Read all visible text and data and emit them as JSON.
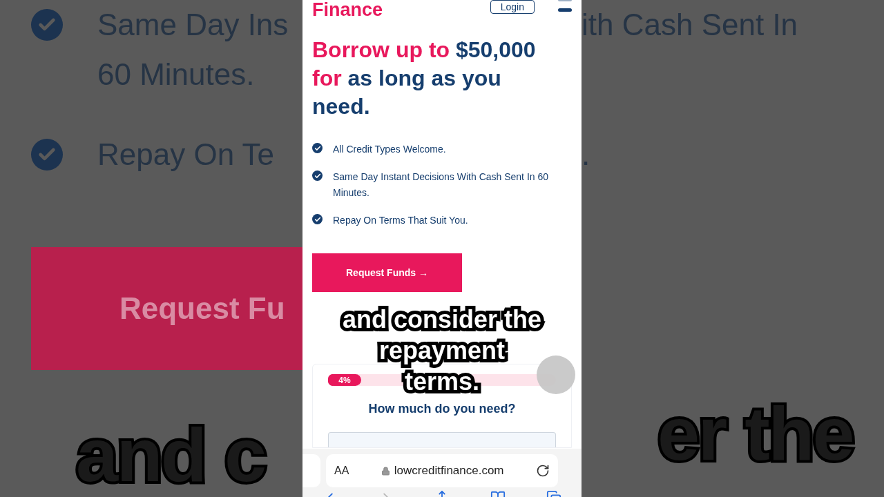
{
  "backdrop": {
    "left": {
      "lines": [
        {
          "kind": "check",
          "text": "Same Day Ins"
        },
        {
          "kind": "plain",
          "text": "60 Minutes."
        },
        {
          "kind": "check",
          "text": "Repay On Te"
        }
      ],
      "button": "Request Fu",
      "caption": "and c"
    },
    "right": {
      "lines": [
        "ith Cash Sent In",
        "."
      ],
      "caption": "er the"
    }
  },
  "header": {
    "logo": "Finance",
    "login": "Login"
  },
  "heading": [
    {
      "text": "Borrow up to ",
      "color": "#e8185c"
    },
    {
      "text": "$50,000 ",
      "color": "#163e6e"
    },
    {
      "text": "for ",
      "color": "#e8185c"
    },
    {
      "text": "as long as you need.",
      "color": "#163e6e"
    }
  ],
  "features": [
    "All Credit Types Welcome.",
    "Same Day Instant Decisions With Cash Sent In 60 Minutes.",
    "Repay On Terms That Suit You."
  ],
  "cta": "Request Funds →",
  "form": {
    "progress": {
      "label": "4%",
      "level": 0.04
    },
    "question": "How much do you need?"
  },
  "caption": [
    "and consider the",
    "repayment",
    "terms."
  ],
  "browser": {
    "text_size": "AA",
    "url": "lowcreditfinance.com"
  }
}
